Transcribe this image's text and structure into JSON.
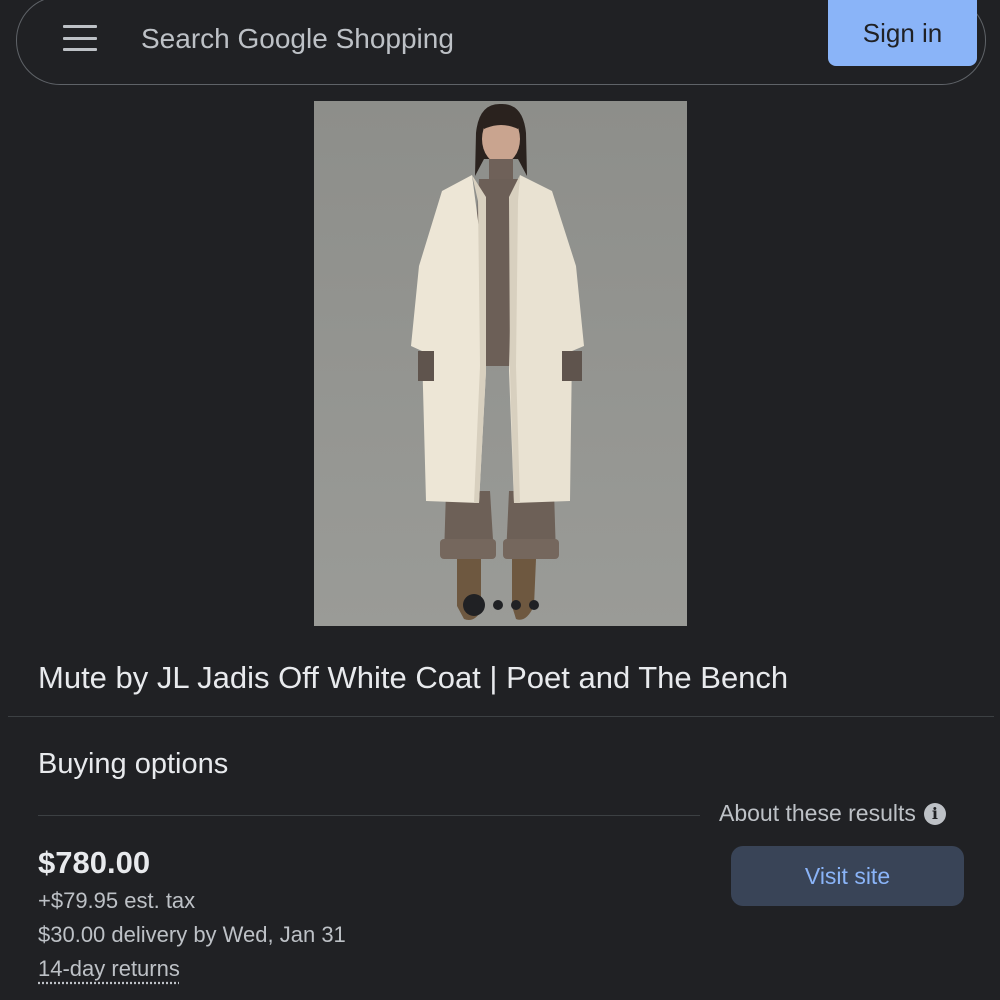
{
  "header": {
    "search_placeholder": "Search Google Shopping",
    "sign_in_label": "Sign in"
  },
  "product": {
    "image_description_icon": "product-photo",
    "image_dots_count": 4,
    "active_dot": 0,
    "title": "Mute by JL Jadis Off White Coat | Poet and The Bench"
  },
  "buying_options": {
    "section_title": "Buying options",
    "about_label": "About these results",
    "offer": {
      "price": "$780.00",
      "tax": "+$79.95 est. tax",
      "delivery": "$30.00 delivery by Wed, Jan 31",
      "returns": "14-day returns",
      "visit_label": "Visit site"
    }
  },
  "colors": {
    "background": "#202124",
    "accent": "#8ab4f8",
    "visit_button_bg": "#394457"
  }
}
